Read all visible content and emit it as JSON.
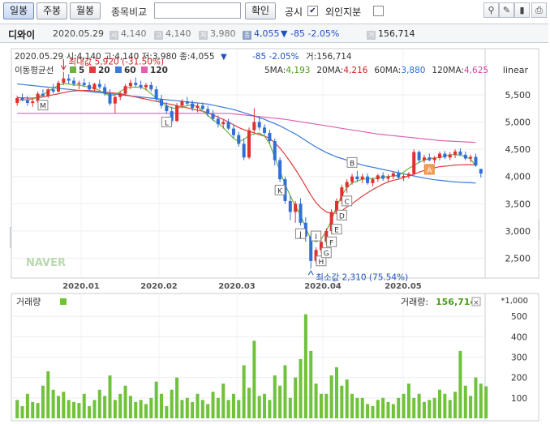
{
  "toolbar": {
    "period_daily": "일봉",
    "period_weekly": "주봉",
    "period_monthly": "월봉",
    "compare_label": "종목비교",
    "compare_input_value": "",
    "confirm": "확인",
    "disclosure": "공시",
    "disclosure_checked": "✔",
    "foreign": "외인지분",
    "foreign_checked": ""
  },
  "info": {
    "name": "디와이",
    "date": "2020.05.29",
    "open": "4,140",
    "high": "4,140",
    "low": "3,980",
    "close": "4,055",
    "change_arrow": "▼",
    "change": "-85",
    "change_pct": "-2.05%",
    "volume": "156,714"
  },
  "chart_data": {
    "type": "candlestick",
    "header": {
      "date": "2020.05.29",
      "open_label": "시:",
      "open": "4,140",
      "high_label": "고:",
      "high": "4,140",
      "low_label": "저:",
      "low": "3,980",
      "close_label": "종:",
      "close": "4,055",
      "change_arrow": "▼",
      "change": "-85",
      "change_pct": "-2.05%",
      "volume_label": "거:",
      "volume": "156,714"
    },
    "legend_title": "이동평균선",
    "legend": [
      {
        "name": "5",
        "color": "#6db33f"
      },
      {
        "name": "20",
        "color": "#e03c3c"
      },
      {
        "name": "60",
        "color": "#3a7ad9"
      },
      {
        "name": "120",
        "color": "#e25fb0"
      }
    ],
    "ma_values": [
      {
        "label": "5MA:",
        "value": "4,193",
        "color": "#4a9a1c"
      },
      {
        "label": "20MA:",
        "value": "4,216",
        "color": "#d42020"
      },
      {
        "label": "60MA:",
        "value": "3,880",
        "color": "#2a6bd0"
      },
      {
        "label": "120MA:",
        "value": "4,625",
        "color": "#d8409c"
      }
    ],
    "scale_label": "linear",
    "y_ticks": [
      2500,
      3000,
      3500,
      4000,
      4500,
      5000,
      5500
    ],
    "y_tick_labels": [
      "2,500",
      "3,000",
      "3,500",
      "4,000",
      "4,500",
      "5,000",
      "5,500"
    ],
    "ylim": [
      2150,
      6050
    ],
    "x_ticks": [
      "2020.01",
      "2020.02",
      "2020.03",
      "2020.04",
      "2020.05"
    ],
    "annotations": {
      "max_label": "최대값 5,920 (-31.50%)",
      "min_label": "최소값 2,310 (75.54%)"
    },
    "markers": [
      "M",
      "L",
      "K",
      "J",
      "I",
      "H",
      "G",
      "F",
      "E",
      "D",
      "C",
      "B",
      "A"
    ],
    "watermark": "NAVER",
    "candles": [
      [
        5350,
        5480,
        5300,
        5440
      ],
      [
        5440,
        5520,
        5380,
        5400
      ],
      [
        5400,
        5480,
        5300,
        5350
      ],
      [
        5350,
        5420,
        5280,
        5380
      ],
      [
        5380,
        5560,
        5350,
        5520
      ],
      [
        5520,
        5600,
        5460,
        5480
      ],
      [
        5480,
        5620,
        5440,
        5600
      ],
      [
        5600,
        5700,
        5520,
        5560
      ],
      [
        5560,
        5760,
        5540,
        5720
      ],
      [
        5720,
        5920,
        5680,
        5800
      ],
      [
        5800,
        5880,
        5700,
        5760
      ],
      [
        5760,
        5820,
        5660,
        5700
      ],
      [
        5700,
        5760,
        5600,
        5720
      ],
      [
        5720,
        5800,
        5640,
        5680
      ],
      [
        5680,
        5740,
        5560,
        5600
      ],
      [
        5600,
        5720,
        5560,
        5700
      ],
      [
        5700,
        5780,
        5600,
        5640
      ],
      [
        5640,
        5700,
        5480,
        5520
      ],
      [
        5520,
        5600,
        5300,
        5340
      ],
      [
        5340,
        5500,
        5160,
        5460
      ],
      [
        5460,
        5560,
        5400,
        5520
      ],
      [
        5520,
        5700,
        5480,
        5660
      ],
      [
        5660,
        5780,
        5600,
        5720
      ],
      [
        5720,
        5820,
        5640,
        5680
      ],
      [
        5680,
        5760,
        5600,
        5640
      ],
      [
        5640,
        5720,
        5580,
        5680
      ],
      [
        5680,
        5740,
        5560,
        5600
      ],
      [
        5600,
        5660,
        5380,
        5420
      ],
      [
        5420,
        5500,
        5250,
        5300
      ],
      [
        5300,
        5360,
        5150,
        5200
      ],
      [
        5200,
        5280,
        4950,
        5020
      ],
      [
        5020,
        5350,
        5000,
        5300
      ],
      [
        5300,
        5420,
        5250,
        5380
      ],
      [
        5380,
        5460,
        5300,
        5340
      ],
      [
        5340,
        5400,
        5200,
        5260
      ],
      [
        5260,
        5340,
        5180,
        5300
      ],
      [
        5300,
        5360,
        5220,
        5240
      ],
      [
        5240,
        5300,
        5100,
        5150
      ],
      [
        5150,
        5220,
        5020,
        5060
      ],
      [
        5060,
        5120,
        4900,
        4960
      ],
      [
        4960,
        5040,
        4880,
        5000
      ],
      [
        5000,
        5060,
        4850,
        4880
      ],
      [
        4880,
        4960,
        4700,
        4760
      ],
      [
        4760,
        4820,
        4550,
        4600
      ],
      [
        4600,
        4700,
        4300,
        4350
      ],
      [
        4350,
        4900,
        4320,
        4850
      ],
      [
        4850,
        5250,
        4800,
        5000
      ],
      [
        5000,
        5100,
        4850,
        4900
      ],
      [
        4900,
        4960,
        4750,
        4800
      ],
      [
        4800,
        4860,
        4600,
        4650
      ],
      [
        4650,
        4700,
        4200,
        4300
      ],
      [
        4300,
        4350,
        3900,
        3950
      ],
      [
        3950,
        4000,
        3500,
        3550
      ],
      [
        3550,
        3650,
        3200,
        3350
      ],
      [
        3350,
        3550,
        3150,
        3500
      ],
      [
        3500,
        3600,
        3100,
        3150
      ],
      [
        3150,
        3250,
        2800,
        2900
      ],
      [
        2900,
        2960,
        2310,
        2450
      ],
      [
        2450,
        2700,
        2400,
        2650
      ],
      [
        2650,
        2850,
        2600,
        2800
      ],
      [
        2800,
        3050,
        2750,
        3000
      ],
      [
        3000,
        3400,
        2950,
        3350
      ],
      [
        3350,
        3600,
        3300,
        3550
      ],
      [
        3550,
        3850,
        3500,
        3800
      ],
      [
        3800,
        3950,
        3700,
        3900
      ],
      [
        3900,
        4050,
        3850,
        4000
      ],
      [
        4000,
        4100,
        3900,
        3950
      ],
      [
        3950,
        4050,
        3880,
        4000
      ],
      [
        4000,
        4060,
        3850,
        3880
      ],
      [
        3880,
        3980,
        3820,
        3950
      ],
      [
        3950,
        4050,
        3900,
        4020
      ],
      [
        4020,
        4080,
        3920,
        3960
      ],
      [
        3960,
        4040,
        3900,
        4000
      ],
      [
        4000,
        4100,
        3950,
        4060
      ],
      [
        4060,
        4120,
        3950,
        3980
      ],
      [
        3980,
        4050,
        3920,
        4010
      ],
      [
        4010,
        4080,
        3960,
        4050
      ],
      [
        4050,
        4500,
        4040,
        4450
      ],
      [
        4450,
        4480,
        4250,
        4300
      ],
      [
        4300,
        4400,
        4250,
        4350
      ],
      [
        4350,
        4420,
        4280,
        4300
      ],
      [
        4300,
        4380,
        4240,
        4340
      ],
      [
        4340,
        4460,
        4300,
        4420
      ],
      [
        4420,
        4470,
        4320,
        4350
      ],
      [
        4350,
        4450,
        4300,
        4400
      ],
      [
        4400,
        4500,
        4340,
        4460
      ],
      [
        4460,
        4520,
        4380,
        4400
      ],
      [
        4400,
        4460,
        4300,
        4330
      ],
      [
        4330,
        4400,
        4260,
        4360
      ],
      [
        4360,
        4420,
        4180,
        4200
      ],
      [
        4140,
        4140,
        3980,
        4055
      ]
    ],
    "ma5": [
      5400,
      5410,
      5410,
      5420,
      5460,
      5500,
      5560,
      5620,
      5680,
      5700,
      5700,
      5680,
      5680,
      5660,
      5640,
      5620,
      5580,
      5520,
      5480,
      5500,
      5560,
      5620,
      5640,
      5640,
      5640,
      5600,
      5520,
      5440,
      5360,
      5300,
      5260,
      5250,
      5280,
      5300,
      5320,
      5280,
      5200,
      5120,
      5040,
      4980,
      4900,
      4800,
      4700,
      4640,
      4680,
      4750,
      4780,
      4800,
      4740,
      4600,
      4350,
      4100,
      3850,
      3650,
      3450,
      3300,
      3050,
      2850,
      2800,
      2850,
      3000,
      3200,
      3450,
      3650,
      3800,
      3880,
      3920,
      3950,
      3960,
      3960,
      3980,
      3990,
      4000,
      4010,
      4020,
      4080,
      4150,
      4200,
      4260,
      4300,
      4330,
      4340,
      4350,
      4380,
      4400,
      4400,
      4390,
      4370,
      4320,
      4193
    ],
    "ma20": [
      5450,
      5445,
      5440,
      5440,
      5450,
      5460,
      5480,
      5500,
      5520,
      5540,
      5560,
      5570,
      5580,
      5580,
      5580,
      5570,
      5560,
      5550,
      5540,
      5530,
      5520,
      5500,
      5480,
      5460,
      5440,
      5420,
      5400,
      5380,
      5360,
      5340,
      5320,
      5300,
      5280,
      5260,
      5240,
      5220,
      5200,
      5170,
      5130,
      5090,
      5050,
      5000,
      4950,
      4900,
      4860,
      4830,
      4800,
      4770,
      4740,
      4700,
      4620,
      4520,
      4400,
      4270,
      4130,
      3980,
      3820,
      3660,
      3520,
      3420,
      3350,
      3320,
      3330,
      3370,
      3440,
      3500,
      3570,
      3640,
      3700,
      3760,
      3810,
      3860,
      3900,
      3930,
      3950,
      3980,
      4010,
      4040,
      4080,
      4110,
      4140,
      4160,
      4180,
      4190,
      4200,
      4210,
      4215,
      4218,
      4217,
      4216
    ],
    "ma60": [
      5700,
      5690,
      5680,
      5670,
      5660,
      5650,
      5640,
      5630,
      5620,
      5610,
      5600,
      5590,
      5580,
      5570,
      5560,
      5550,
      5540,
      5530,
      5520,
      5510,
      5500,
      5490,
      5480,
      5470,
      5460,
      5450,
      5440,
      5430,
      5420,
      5410,
      5400,
      5390,
      5380,
      5370,
      5360,
      5350,
      5340,
      5330,
      5310,
      5290,
      5270,
      5250,
      5230,
      5200,
      5170,
      5140,
      5110,
      5080,
      5050,
      5010,
      4970,
      4930,
      4880,
      4830,
      4780,
      4720,
      4660,
      4600,
      4540,
      4490,
      4440,
      4400,
      4360,
      4330,
      4300,
      4270,
      4240,
      4210,
      4190,
      4170,
      4150,
      4130,
      4110,
      4090,
      4070,
      4050,
      4030,
      4010,
      3990,
      3970,
      3955,
      3940,
      3930,
      3920,
      3910,
      3900,
      3895,
      3890,
      3885,
      3880
    ],
    "ma120": [
      5160,
      5160,
      5160,
      5160,
      5160,
      5160,
      5160,
      5160,
      5160,
      5160,
      5160,
      5160,
      5160,
      5160,
      5160,
      5160,
      5160,
      5160,
      5160,
      5160,
      5160,
      5160,
      5160,
      5160,
      5160,
      5160,
      5160,
      5160,
      5160,
      5160,
      5160,
      5160,
      5160,
      5160,
      5160,
      5160,
      5160,
      5160,
      5160,
      5160,
      5160,
      5160,
      5150,
      5140,
      5130,
      5120,
      5110,
      5100,
      5090,
      5080,
      5070,
      5060,
      5050,
      5035,
      5020,
      5005,
      4990,
      4975,
      4960,
      4945,
      4930,
      4915,
      4900,
      4885,
      4870,
      4855,
      4840,
      4825,
      4810,
      4795,
      4780,
      4770,
      4760,
      4750,
      4740,
      4730,
      4720,
      4710,
      4700,
      4690,
      4680,
      4670,
      4660,
      4655,
      4650,
      4645,
      4640,
      4635,
      4630,
      4625
    ],
    "volume_panel": {
      "label": "거래량",
      "unit": "*1,000",
      "current_label": "거래량:",
      "current": "156,714",
      "y_ticks": [
        100,
        200,
        300,
        400,
        500
      ],
      "ylim": [
        0,
        560
      ],
      "values": [
        90,
        60,
        120,
        80,
        75,
        160,
        230,
        140,
        110,
        130,
        90,
        80,
        75,
        120,
        60,
        90,
        140,
        110,
        210,
        90,
        120,
        160,
        110,
        80,
        90,
        70,
        100,
        180,
        120,
        60,
        140,
        200,
        90,
        100,
        80,
        120,
        90,
        70,
        130,
        100,
        170,
        90,
        120,
        90,
        260,
        150,
        380,
        110,
        120,
        90,
        210,
        160,
        260,
        100,
        200,
        290,
        510,
        330,
        170,
        120,
        120,
        210,
        250,
        160,
        190,
        120,
        100,
        100,
        70,
        60,
        90,
        100,
        80,
        70,
        100,
        120,
        170,
        100,
        120,
        80,
        90,
        100,
        140,
        120,
        90,
        130,
        330,
        160,
        110,
        200,
        170,
        157
      ]
    }
  }
}
